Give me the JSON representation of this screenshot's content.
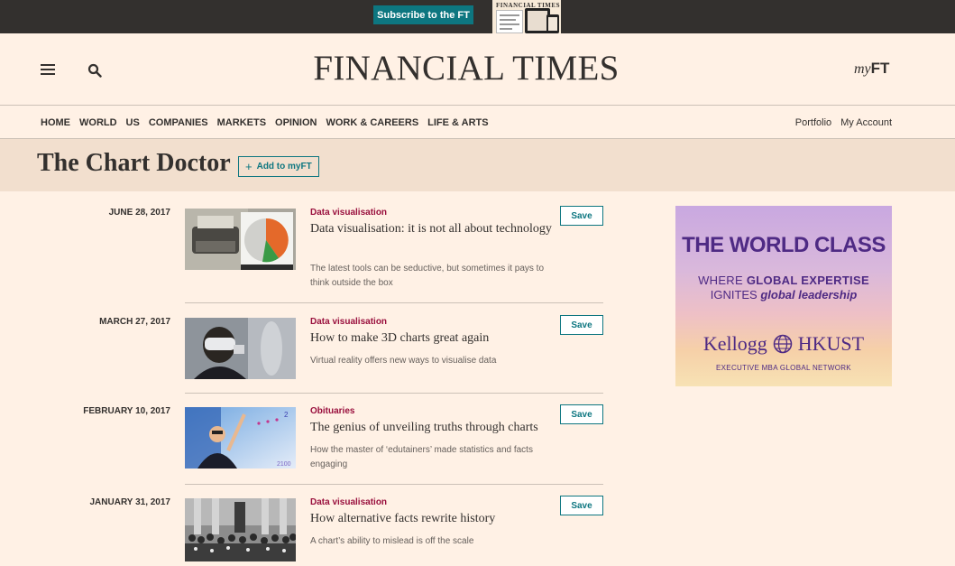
{
  "topbar": {
    "subscribe_label": "Subscribe to the FT",
    "promo_masthead": "FINANCIAL TIMES"
  },
  "header": {
    "masthead": "FINANCIAL TIMES",
    "myft_my": "my",
    "myft_ft": "FT"
  },
  "nav": {
    "items": [
      "HOME",
      "WORLD",
      "US",
      "COMPANIES",
      "MARKETS",
      "OPINION",
      "WORK & CAREERS",
      "LIFE & ARTS"
    ],
    "right": [
      "Portfolio",
      "My Account"
    ]
  },
  "page": {
    "title": "The Chart Doctor",
    "add_myft_label": "Add to myFT",
    "add_icon": "+"
  },
  "articles": [
    {
      "date": "JUNE 28, 2017",
      "tag": "Data visualisation",
      "headline": "Data visualisation: it is not all about technology",
      "standfirst": "The latest tools can be seductive, but sometimes it pays to think outside the box",
      "save_label": "Save"
    },
    {
      "date": "MARCH 27, 2017",
      "tag": "Data visualisation",
      "headline": "How to make 3D charts great again",
      "standfirst": "Virtual reality offers new ways to visualise data",
      "save_label": "Save"
    },
    {
      "date": "FEBRUARY 10, 2017",
      "tag": "Obituaries",
      "headline": "The genius of unveiling truths through charts",
      "standfirst": "How the master of ‘edutainers’ made statistics and facts engaging",
      "save_label": "Save",
      "thumb_labels": [
        "2",
        "2100"
      ]
    },
    {
      "date": "JANUARY 31, 2017",
      "tag": "Data visualisation",
      "headline": "How alternative facts rewrite history",
      "standfirst": "A chart’s ability to mislead is off the scale",
      "save_label": "Save"
    }
  ],
  "ad": {
    "headline": "THE WORLD CLASS",
    "sub1_prefix": "WHERE ",
    "sub1_bold": "GLOBAL EXPERTISE",
    "sub2_prefix": "IGNITES ",
    "sub2_emph": "global leadership",
    "logo_left": "Kellogg",
    "logo_right": "HKUST",
    "tagline": "EXECUTIVE MBA GLOBAL NETWORK"
  },
  "colors": {
    "background": "#fff1e5",
    "title_band": "#f2dfce",
    "topbar": "#33302e",
    "teal": "#0d7680",
    "claret": "#990f3d",
    "ad_purple": "#4e2a84"
  },
  "icons": [
    "menu-icon",
    "search-icon",
    "plus-icon",
    "globe-icon"
  ]
}
